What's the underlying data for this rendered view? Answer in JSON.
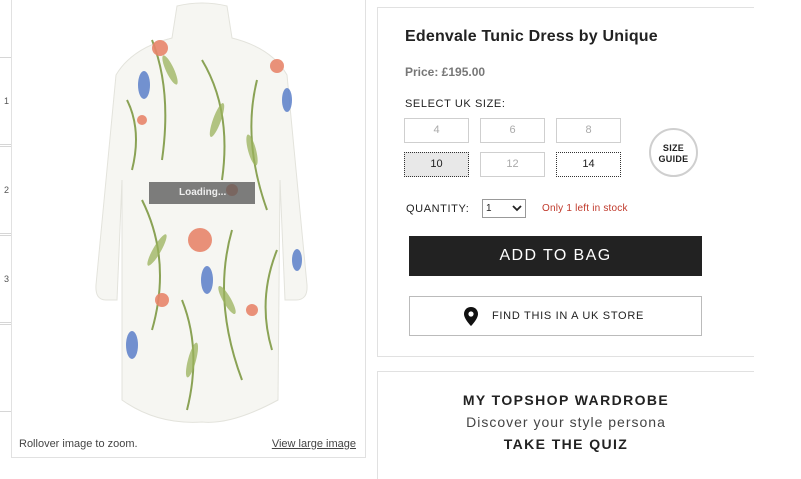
{
  "thumbnails": [
    "1",
    "2",
    "3"
  ],
  "image": {
    "loading_text": "Loading...",
    "zoom_hint": "Rollover image to zoom.",
    "large_link": "View large image"
  },
  "product": {
    "title": "Edenvale Tunic Dress by Unique",
    "price": "Price: £195.00",
    "size_label": "SELECT UK SIZE:",
    "sizes": [
      "4",
      "6",
      "8",
      "10",
      "12",
      "14"
    ],
    "selected_size": "10",
    "available_sizes": [
      "10",
      "14"
    ],
    "size_guide_line1": "SIZE",
    "size_guide_line2": "GUIDE",
    "quantity_label": "QUANTITY:",
    "quantity_value": "1",
    "stock_message": "Only 1 left in stock",
    "add_to_bag": "ADD TO BAG",
    "find_store": "FIND THIS IN A UK STORE"
  },
  "wardrobe": {
    "title": "MY TOPSHOP WARDROBE",
    "subtitle": "Discover your style persona",
    "cta": "TAKE THE QUIZ"
  },
  "colors": {
    "primary_button": "#222222",
    "stock_warning": "#c0392b",
    "border": "#e1e1e1"
  }
}
